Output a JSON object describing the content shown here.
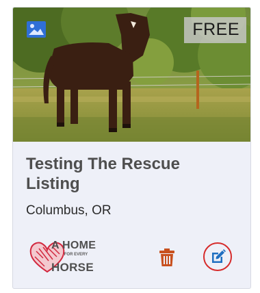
{
  "listing": {
    "price_tag": "FREE",
    "title": "Testing The Rescue Listing",
    "location": "Columbus, OR"
  },
  "logo": {
    "line1": "A HOME",
    "line2": "FOR EVERY",
    "line3": "HORSE"
  },
  "icons": {
    "photo_badge": "image-icon",
    "delete": "trash-icon",
    "edit": "edit-icon"
  },
  "colors": {
    "card_background": "#eef0f8",
    "title": "#4e4e4e",
    "trash": "#c8501e",
    "edit": "#1f6fc1",
    "edit_ring": "#d62b2b",
    "photo_badge": "#2f6fd6"
  }
}
